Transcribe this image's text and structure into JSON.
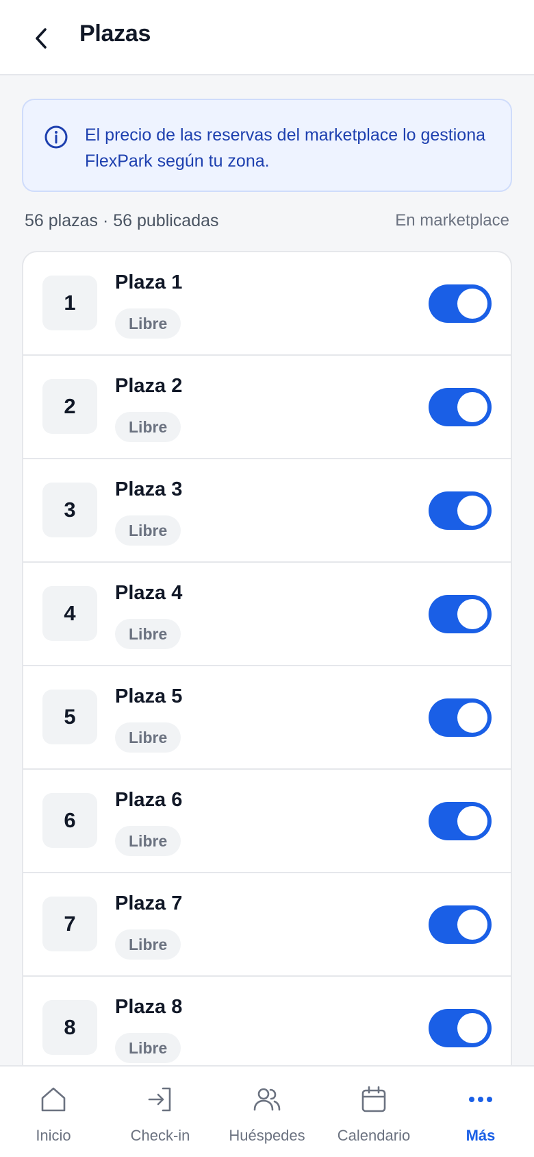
{
  "header": {
    "title": "Plazas",
    "back_icon": "chevron-left-icon"
  },
  "info_banner": {
    "icon": "info-icon",
    "text": "El precio de las reservas del marketplace lo gestiona FlexPark según tu zona."
  },
  "summary": {
    "left": "56 plazas · 56 publicadas",
    "right": "En marketplace"
  },
  "plazas": [
    {
      "number": "1",
      "title": "Plaza 1",
      "status": "Libre",
      "published": true
    },
    {
      "number": "2",
      "title": "Plaza 2",
      "status": "Libre",
      "published": true
    },
    {
      "number": "3",
      "title": "Plaza 3",
      "status": "Libre",
      "published": true
    },
    {
      "number": "4",
      "title": "Plaza 4",
      "status": "Libre",
      "published": true
    },
    {
      "number": "5",
      "title": "Plaza 5",
      "status": "Libre",
      "published": true
    },
    {
      "number": "6",
      "title": "Plaza 6",
      "status": "Libre",
      "published": true
    },
    {
      "number": "7",
      "title": "Plaza 7",
      "status": "Libre",
      "published": true
    },
    {
      "number": "8",
      "title": "Plaza 8",
      "status": "Libre",
      "published": true
    }
  ],
  "bottom_nav": [
    {
      "label": "Inicio",
      "icon": "home-icon",
      "active": false
    },
    {
      "label": "Check-in",
      "icon": "check-in-icon",
      "active": false
    },
    {
      "label": "Huéspedes",
      "icon": "users-icon",
      "active": false
    },
    {
      "label": "Calendario",
      "icon": "calendar-icon",
      "active": false
    },
    {
      "label": "Más",
      "icon": "more-icon",
      "active": true
    }
  ],
  "colors": {
    "accent": "#1a5fe6",
    "banner_bg": "#eef3ff",
    "banner_text": "#1e40af"
  }
}
